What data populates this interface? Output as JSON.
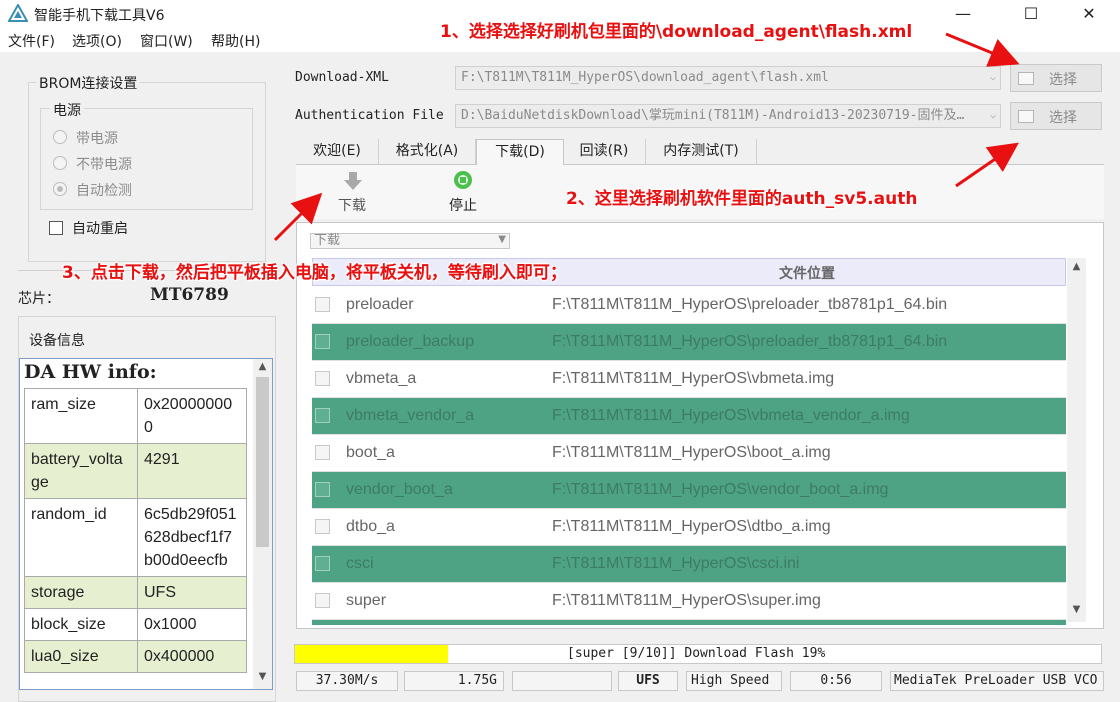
{
  "window": {
    "title": "智能手机下载工具V6",
    "controls": {
      "minimize": "—",
      "maximize": "☐",
      "close": "✕"
    }
  },
  "menu": [
    "文件(F)",
    "选项(O)",
    "窗口(W)",
    "帮助(H)"
  ],
  "left": {
    "brom_title": "BROM连接设置",
    "power_title": "电源",
    "radios": [
      {
        "label": "带电源",
        "checked": false
      },
      {
        "label": "不带电源",
        "checked": false
      },
      {
        "label": "自动检测",
        "checked": true
      }
    ],
    "auto_reboot_label": "自动重启",
    "chip_label": "芯片：",
    "chip_value": "MT6789",
    "device_info_title": "设备信息",
    "da_header": "DA HW info:",
    "info_rows": [
      {
        "key": "ram_size",
        "value": "0x200000000"
      },
      {
        "key": "battery_voltage",
        "value": "4291"
      },
      {
        "key": "random_id",
        "value": "6c5db29f051628dbecf1f7b00d0eecfb"
      },
      {
        "key": "storage",
        "value": "UFS"
      },
      {
        "key": "block_size",
        "value": "0x1000"
      },
      {
        "key": "lua0_size",
        "value": "0x400000"
      }
    ]
  },
  "top": {
    "download_xml_label": "Download-XML",
    "download_xml_value": "F:\\T811M\\T811M_HyperOS\\download_agent\\flash.xml",
    "auth_label": "Authentication File",
    "auth_value": "D:\\BaiduNetdiskDownload\\掌玩mini(T811M)-Android13-20230719-固件及…",
    "choose_label": "选择"
  },
  "tabs": [
    "欢迎(E)",
    "格式化(A)",
    "下载(D)",
    "回读(R)",
    "内存测试(T)"
  ],
  "toolbar": {
    "download_label": "下载",
    "stop_label": "停止"
  },
  "mode_select": "下载",
  "table": {
    "header_location": "文件位置",
    "rows": [
      {
        "name": "preloader",
        "path": "F:\\T811M\\T811M_HyperOS\\preloader_tb8781p1_64.bin",
        "checked": true
      },
      {
        "name": "preloader_backup",
        "path": "F:\\T811M\\T811M_HyperOS\\preloader_tb8781p1_64.bin",
        "checked": true
      },
      {
        "name": "vbmeta_a",
        "path": "F:\\T811M\\T811M_HyperOS\\vbmeta.img",
        "checked": true
      },
      {
        "name": "vbmeta_vendor_a",
        "path": "F:\\T811M\\T811M_HyperOS\\vbmeta_vendor_a.img",
        "checked": true
      },
      {
        "name": "boot_a",
        "path": "F:\\T811M\\T811M_HyperOS\\boot_a.img",
        "checked": true
      },
      {
        "name": "vendor_boot_a",
        "path": "F:\\T811M\\T811M_HyperOS\\vendor_boot_a.img",
        "checked": true
      },
      {
        "name": "dtbo_a",
        "path": "F:\\T811M\\T811M_HyperOS\\dtbo_a.img",
        "checked": true
      },
      {
        "name": "csci",
        "path": "F:\\T811M\\T811M_HyperOS\\csci.ini",
        "checked": true
      },
      {
        "name": "super",
        "path": "F:\\T811M\\T811M_HyperOS\\super.img",
        "checked": true
      }
    ]
  },
  "progress": {
    "fraction": 0.19,
    "text": "[super [9/10]] Download Flash 19%",
    "color": "#ffff00"
  },
  "status": [
    "37.30M/s",
    "1.75G",
    "",
    "UFS",
    "High Speed",
    "0:56",
    "MediaTek PreLoader USB VCO"
  ],
  "annotations": {
    "a1": "1、选择选择好刷机包里面的\\download_agent\\flash.xml",
    "a2": "2、这里选择刷机软件里面的auth_sv5.auth",
    "a3": "3、点击下载，然后把平板插入电脑，将平板关机，等待刷入即可；"
  },
  "colors": {
    "row_highlight": "#4ea384",
    "annotation": "#e81010",
    "info_highlight": "#e6efcf"
  }
}
